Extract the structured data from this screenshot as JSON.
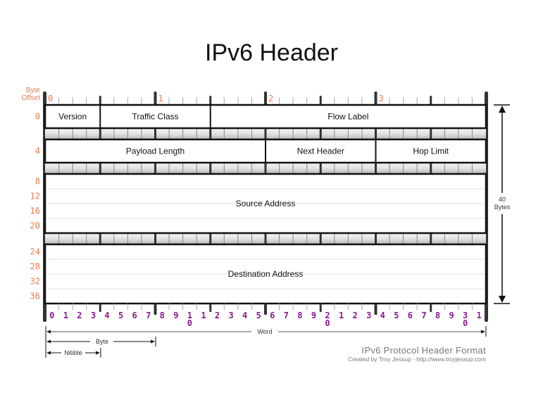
{
  "title": "IPv6 Header",
  "byte_offset_label": [
    "Byte",
    "Offset"
  ],
  "byte_labels": [
    "0",
    "1",
    "2",
    "3"
  ],
  "rows": [
    {
      "offset": "0",
      "fields": [
        {
          "name": "Version",
          "bits": 4
        },
        {
          "name": "Traffic Class",
          "bits": 8
        },
        {
          "name": "Flow Label",
          "bits": 20
        }
      ]
    },
    {
      "offset": "4",
      "fields": [
        {
          "name": "Payload Length",
          "bits": 16
        },
        {
          "name": "Next Header",
          "bits": 8
        },
        {
          "name": "Hop Limit",
          "bits": 8
        }
      ]
    },
    {
      "offsets": [
        "8",
        "12",
        "16",
        "20"
      ],
      "fields": [
        {
          "name": "Source Address",
          "bits": 32
        }
      ],
      "words": 4
    },
    {
      "offsets": [
        "24",
        "28",
        "32",
        "36"
      ],
      "fields": [
        {
          "name": "Destination Address",
          "bits": 32
        }
      ],
      "words": 4
    }
  ],
  "bit_numbers": [
    "0",
    "1",
    "2",
    "3",
    "4",
    "5",
    "6",
    "7",
    "8",
    "9",
    "1|0",
    "1",
    "2",
    "3",
    "4",
    "5",
    "6",
    "7",
    "8",
    "9",
    "2|0",
    "1",
    "2",
    "3",
    "4",
    "5",
    "6",
    "7",
    "8",
    "9",
    "3|0",
    "1"
  ],
  "size_label": [
    "40",
    "Bytes"
  ],
  "legend": {
    "word": "Word",
    "byte": "Byte",
    "nibble": "Nibble"
  },
  "footer": {
    "title": "IPv6 Protocol Header Format",
    "credit": "Created by Troy Jessup - http://www.troyjessup.com"
  },
  "colors": {
    "offset": "#f0784a",
    "bit_number": "#8a1a8e",
    "border": "#111111"
  }
}
